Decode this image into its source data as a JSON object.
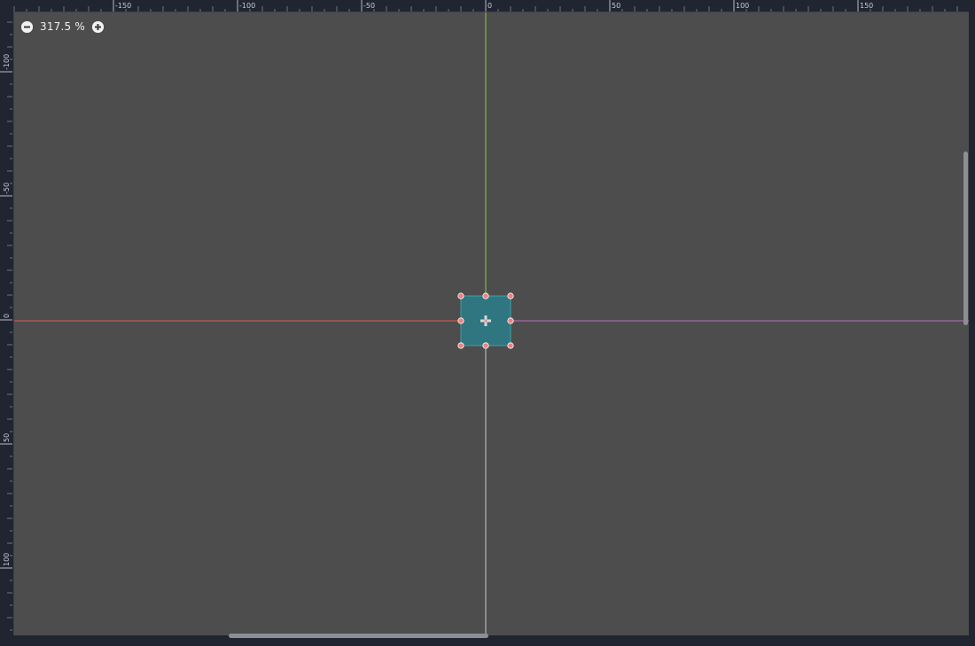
{
  "zoom": {
    "label": "317.5 %",
    "zoom_out_icon": "minus-circle-icon",
    "zoom_in_icon": "plus-circle-icon"
  },
  "rulers": {
    "top_labels": [
      "-150",
      "-100",
      "-50",
      "0",
      "50",
      "100",
      "150"
    ],
    "left_labels": [
      "-100",
      "-50",
      "0",
      "50",
      "100"
    ]
  },
  "colors": {
    "canvas": "#4d4d4d",
    "ruler_bg": "#202531",
    "ruler_tick": "#c7ccd6",
    "x_axis": "#e05a5a",
    "y_axis": "#8fc93a",
    "y_axis_lower": "#c8c8c8",
    "x_axis_right": "#c070c0",
    "node_fill": "#2f7680",
    "node_border": "#41a0a8",
    "handle": "#f08080"
  },
  "selected_node": {
    "name": "selected-control-node",
    "handle_count": 8
  },
  "scrollbars": {
    "vertical": "vertical-scrollbar",
    "horizontal": "horizontal-scrollbar"
  }
}
